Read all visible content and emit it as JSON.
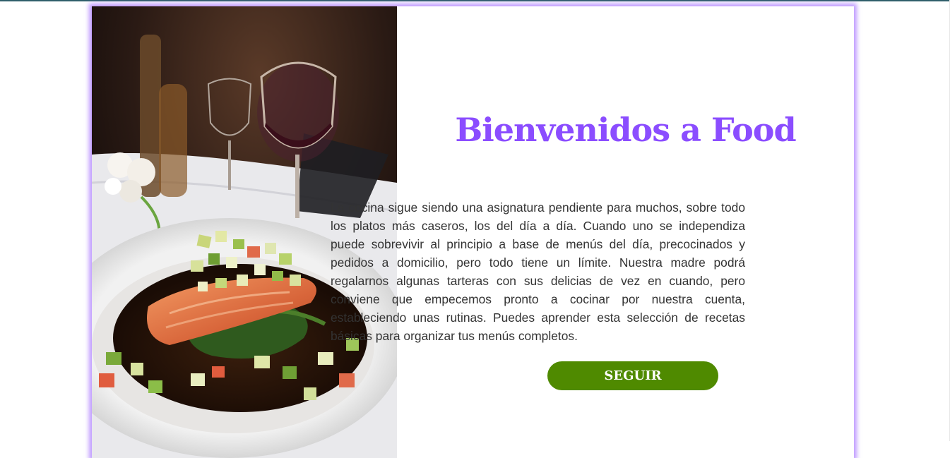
{
  "hero": {
    "title": "Bienvenidos a Food",
    "paragraph": "La cocina sigue siendo una asignatura pendiente para muchos, sobre todo los platos más caseros, los del día a día. Cuando uno se independiza puede sobrevivir al principio a base de menús del día, precocinados y pedidos a domicilio, pero todo tiene un límite. Nuestra madre podrá regalarnos algunas tarteras con sus delicias de vez en cuando, pero conviene que empecemos pronto a cocinar por nuestra cuenta, estableciendo unas rutinas. Puedes aprender esta selección de recetas básicas para organizar tus menús completos.",
    "button_label": "SEGUIR",
    "image": "salmon-dish-photo"
  },
  "colors": {
    "title": "#8b4dff",
    "button": "#4f8a00",
    "card_glow": "#aa78ff"
  }
}
